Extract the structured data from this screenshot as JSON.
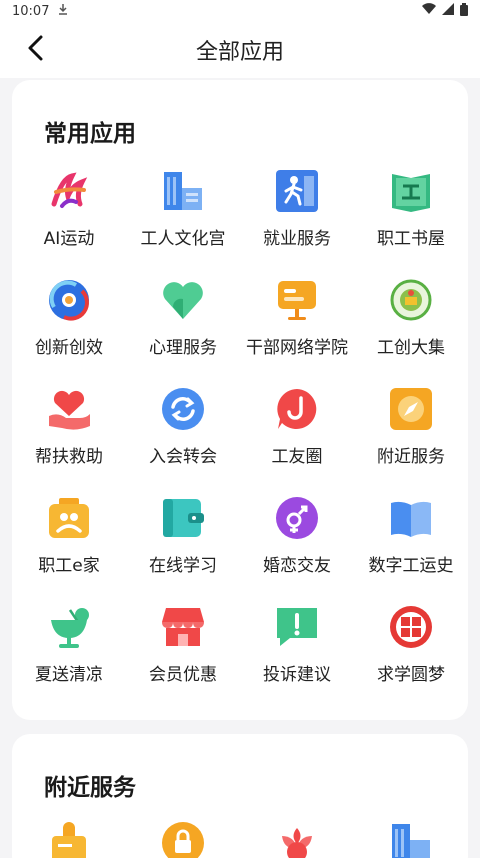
{
  "status_bar": {
    "time": "10:07"
  },
  "header": {
    "title": "全部应用"
  },
  "common_apps": {
    "title": "常用应用",
    "items": [
      {
        "label": "AI运动",
        "icon": "ai-sport-icon"
      },
      {
        "label": "工人文化宫",
        "icon": "culture-palace-icon"
      },
      {
        "label": "就业服务",
        "icon": "employment-icon"
      },
      {
        "label": "职工书屋",
        "icon": "book-house-icon"
      },
      {
        "label": "创新创效",
        "icon": "innovation-icon"
      },
      {
        "label": "心理服务",
        "icon": "heart-icon"
      },
      {
        "label": "干部网络学院",
        "icon": "cadre-college-icon"
      },
      {
        "label": "工创大集",
        "icon": "market-icon"
      },
      {
        "label": "帮扶救助",
        "icon": "helping-hand-icon"
      },
      {
        "label": "入会转会",
        "icon": "transfer-icon"
      },
      {
        "label": "工友圈",
        "icon": "chat-bubble-icon"
      },
      {
        "label": "附近服务",
        "icon": "compass-icon"
      },
      {
        "label": "职工e家",
        "icon": "home-icon"
      },
      {
        "label": "在线学习",
        "icon": "wallet-icon"
      },
      {
        "label": "婚恋交友",
        "icon": "gender-icon"
      },
      {
        "label": "数字工运史",
        "icon": "open-book-icon"
      },
      {
        "label": "夏送清凉",
        "icon": "drink-icon"
      },
      {
        "label": "会员优惠",
        "icon": "shop-icon"
      },
      {
        "label": "投诉建议",
        "icon": "complaint-icon"
      },
      {
        "label": "求学圆梦",
        "icon": "study-seal-icon"
      }
    ]
  },
  "nearby": {
    "title": "附近服务"
  },
  "colors": {
    "blue": "#4a8ef0",
    "green": "#3fc48a",
    "orange": "#f5a623",
    "red": "#f04848",
    "purple": "#9b4ae0"
  }
}
